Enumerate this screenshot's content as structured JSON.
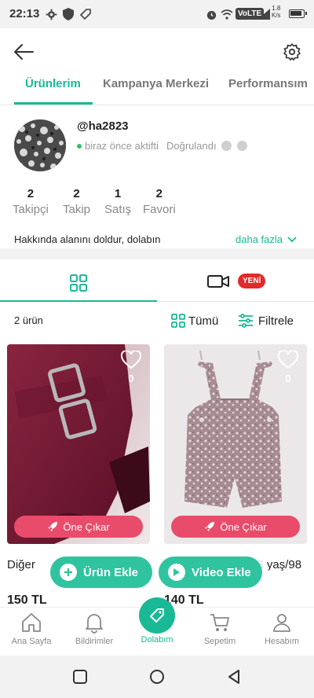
{
  "status_bar": {
    "time": "22:13",
    "volte": "VoLTE",
    "net_speed_value": "1.8",
    "net_speed_unit": "K/s",
    "icons": [
      "gear-icon",
      "shield-icon",
      "location-tag-icon",
      "alarm-icon",
      "wifi-icon",
      "signal-icon",
      "battery-icon"
    ]
  },
  "header": {
    "back_icon": "arrow-left-icon",
    "settings_icon": "gear-icon"
  },
  "tabs": [
    {
      "label": "Ürünlerim",
      "active": true
    },
    {
      "label": "Kampanya Merkezi",
      "active": false
    },
    {
      "label": "Performansım",
      "active": false
    }
  ],
  "profile": {
    "username": "@ha2823",
    "last_active": "biraz önce aktifti",
    "verified": "Doğrulandı",
    "stats": [
      {
        "value": "2",
        "label": "Takipçi"
      },
      {
        "value": "2",
        "label": "Takip"
      },
      {
        "value": "1",
        "label": "Satış"
      },
      {
        "value": "2",
        "label": "Favori"
      }
    ],
    "about_text": "Hakkında alanını doldur, dolabın",
    "more_label": "daha fazla"
  },
  "view_tabs": {
    "new_badge": "YENİ"
  },
  "filter_bar": {
    "count": "2 ürün",
    "all_label": "Tümü",
    "filter_label": "Filtrele"
  },
  "products": [
    {
      "likes": "0",
      "promote_label": "Öne Çıkar",
      "category": "Diğer",
      "price": "150 TL"
    },
    {
      "likes": "0",
      "promote_label": "Öne Çıkar",
      "category": "2-3 yaş/98",
      "price": "140 TL"
    }
  ],
  "actions": {
    "add_product": "Ürün Ekle",
    "add_video": "Video Ekle"
  },
  "bottom_nav": [
    {
      "label": "Ana Sayfa",
      "icon": "home-icon"
    },
    {
      "label": "Bildirimler",
      "icon": "bell-icon"
    },
    {
      "label": "Dolabım",
      "icon": "hanger-tag-icon",
      "active": true
    },
    {
      "label": "Sepetim",
      "icon": "cart-icon"
    },
    {
      "label": "Hesabım",
      "icon": "user-icon"
    }
  ],
  "colors": {
    "accent": "#19b996",
    "promote": "#e84c6a",
    "badge": "#e22a2a"
  }
}
